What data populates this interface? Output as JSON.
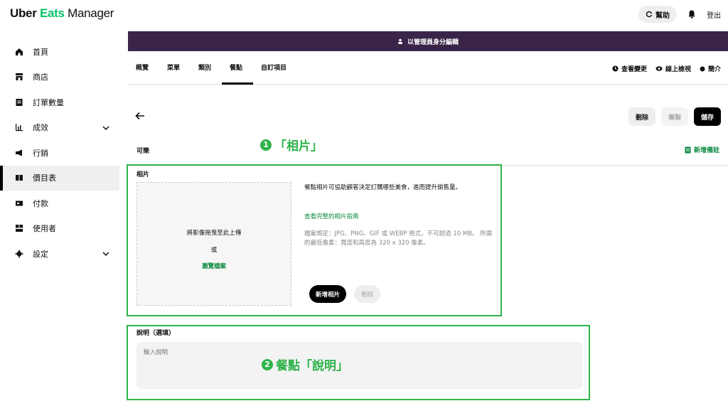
{
  "app": {
    "logo_prefix": "Uber",
    "logo_green": "Eats",
    "logo_suffix": "Manager",
    "help_label": "幫助",
    "logout_label": "登出"
  },
  "sidebar": {
    "items": [
      {
        "label": "首頁",
        "icon": "home-icon"
      },
      {
        "label": "商店",
        "icon": "store-icon"
      },
      {
        "label": "訂單數量",
        "icon": "orders-icon"
      },
      {
        "label": "成效",
        "icon": "chart-icon"
      },
      {
        "label": "行銷",
        "icon": "megaphone-icon"
      },
      {
        "label": "價目表",
        "icon": "menu-book-icon"
      },
      {
        "label": "付款",
        "icon": "payment-icon"
      },
      {
        "label": "使用者",
        "icon": "users-icon"
      },
      {
        "label": "設定",
        "icon": "gear-icon"
      }
    ],
    "active_index": 5
  },
  "admin_bar": {
    "label": "以管理員身分編輯"
  },
  "tabs": {
    "items": [
      "概覽",
      "菜單",
      "類別",
      "餐點",
      "自訂項目"
    ],
    "active": "餐點",
    "right": {
      "view_changes": "查看變更",
      "preview_online": "線上檢視",
      "intro": "簡介"
    }
  },
  "toolbar": {
    "delete_label": "刪除",
    "copy_label": "複製",
    "save_label": "儲存"
  },
  "item": {
    "name": "可樂",
    "add_note_label": "新增備註"
  },
  "photo": {
    "section_label": "相片",
    "drop_text": "將影像拖曳至此上傳",
    "or_text": "或",
    "browse_label": "瀏覽檔案",
    "description": "餐點相片可協助顧客決定訂購哪些美食，進而提升銷售量。",
    "guide_link": "查看完整的相片指南",
    "spec": "檔案規定：JPG、PNG、GIF 或 WEBP 格式，不可超過 10 MB。 所需的最低像素：寬度和高度為 320 x 320 像素。",
    "add_label": "新增相片",
    "delete_label": "刪除"
  },
  "description_field": {
    "label": "說明（選填）",
    "placeholder": "輸入說明"
  },
  "annotations": {
    "one_num": "1",
    "one_text": "「相片」",
    "two_num": "2",
    "two_text": "餐點「說明」"
  },
  "colors": {
    "accent_green": "#2fb34a",
    "admin_bar": "#3a2548",
    "link_green": "#0a8a3f"
  }
}
